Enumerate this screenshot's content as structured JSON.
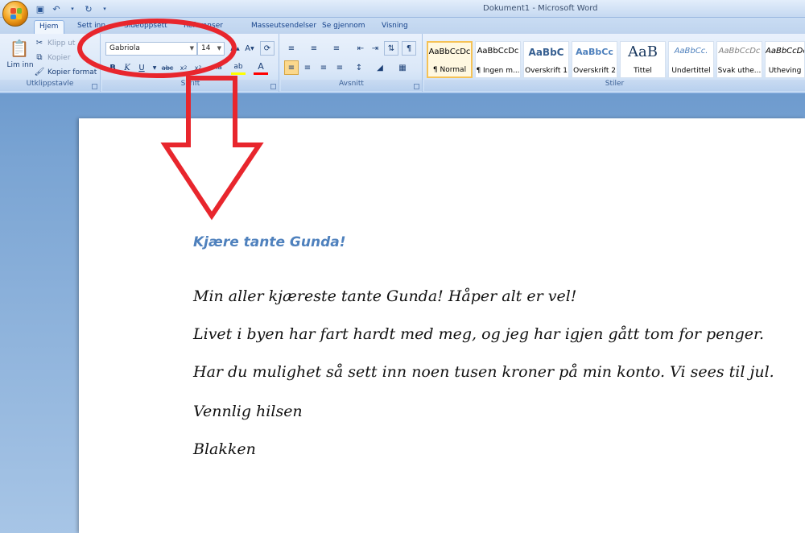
{
  "window": {
    "title": "Dokument1 - Microsoft Word"
  },
  "tabs": [
    {
      "label": "Hjem",
      "active": true
    },
    {
      "label": "Sett inn"
    },
    {
      "label": "Sideoppsett"
    },
    {
      "label": "Referanser"
    },
    {
      "label": "Masseutsendelser"
    },
    {
      "label": "Se gjennom"
    },
    {
      "label": "Visning"
    }
  ],
  "clipboard": {
    "label": "Utklippstavle",
    "paste": "Lim inn",
    "cut": "Klipp ut",
    "copy": "Kopier",
    "format_painter": "Kopier format"
  },
  "font": {
    "label": "Skrift",
    "name": "Gabriola",
    "size": "14"
  },
  "paragraph": {
    "label": "Avsnitt"
  },
  "styles": {
    "label": "Stiler",
    "items": [
      {
        "sample": "AaBbCcDc",
        "name": "¶ Normal"
      },
      {
        "sample": "AaBbCcDc",
        "name": "¶ Ingen m..."
      },
      {
        "sample": "AaBbC",
        "name": "Overskrift 1"
      },
      {
        "sample": "AaBbCc",
        "name": "Overskrift 2"
      },
      {
        "sample": "AaB",
        "name": "Tittel"
      },
      {
        "sample": "AaBbCc.",
        "name": "Undertittel"
      },
      {
        "sample": "AaBbCcDc",
        "name": "Svak uthe..."
      },
      {
        "sample": "AaBbCcDc",
        "name": "Utheving"
      }
    ]
  },
  "document": {
    "heading": "Kjære tante Gunda!",
    "paragraphs": [
      "Min aller kjæreste tante Gunda! Håper alt er vel!",
      "Livet i byen har fart hardt med meg, og jeg har igjen gått tom for penger.",
      "Har du mulighet så sett inn noen tusen kroner på min konto. Vi sees til jul.",
      "Vennlig hilsen",
      "Blakken"
    ]
  },
  "colors": {
    "annotation": "#e8262d",
    "heading": "#4f81bd"
  }
}
